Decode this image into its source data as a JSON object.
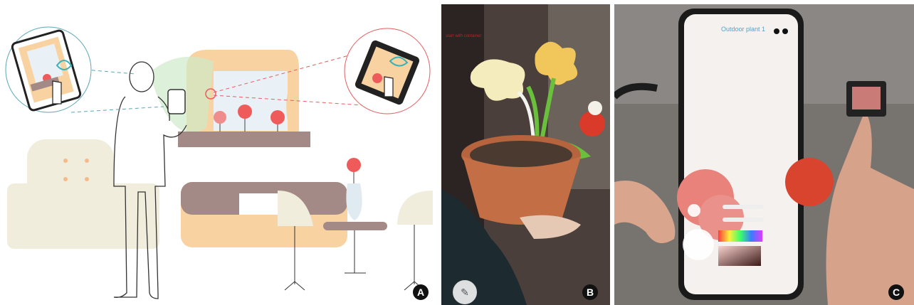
{
  "panels": [
    {
      "id": "A",
      "badge_label": "A"
    },
    {
      "id": "B",
      "badge_label": "B",
      "screen_overlay_text": "start with container"
    },
    {
      "id": "C",
      "badge_label": "C",
      "screen_caption": "Outdoor plant 1"
    }
  ],
  "colors": {
    "sofa": "#f0eddc",
    "peach": "#f9d2a2",
    "brown": "#a48a86",
    "flower": "#ef5b5b",
    "window_glass": "#e9f1f6",
    "ring_blue": "#5aa7b5",
    "ring_red": "#e65d5d",
    "green_glow": "#cfe9c9",
    "badge": "#111111"
  },
  "icons": [
    "phone-icon",
    "flower-icon",
    "hand-pointer-icon",
    "palette-icon",
    "color-picker-icon"
  ]
}
